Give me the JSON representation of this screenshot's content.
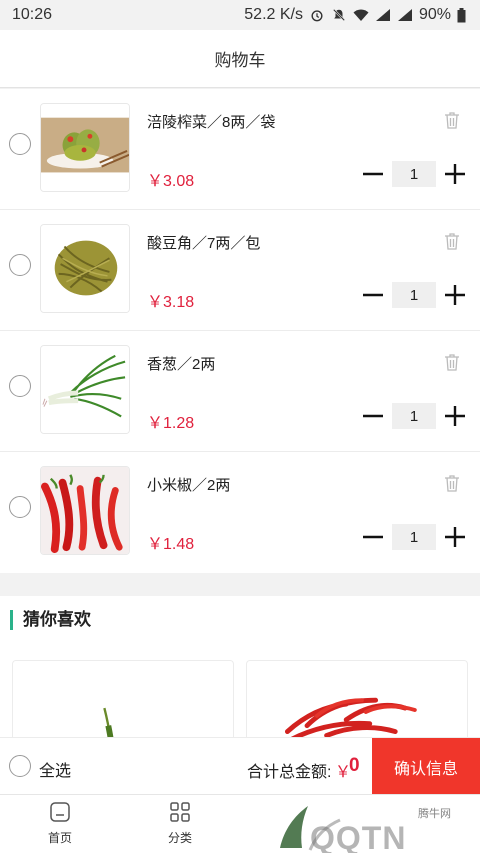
{
  "status_bar": {
    "time": "10:26",
    "speed": "52.2 K/s",
    "battery": "90%"
  },
  "header": {
    "title": "购物车"
  },
  "cart": {
    "items": [
      {
        "name": "涪陵榨菜／8两／袋",
        "price": "￥3.08",
        "qty": "1",
        "image": "pickled-mustard"
      },
      {
        "name": "酸豆角／7两／包",
        "price": "￥3.18",
        "qty": "1",
        "image": "sour-beans"
      },
      {
        "name": "香葱／2两",
        "price": "￥1.28",
        "qty": "1",
        "image": "scallion"
      },
      {
        "name": "小米椒／2两",
        "price": "￥1.48",
        "qty": "1",
        "image": "chili-pepper"
      }
    ]
  },
  "recommend": {
    "title": "猜你喜欢"
  },
  "checkout": {
    "select_all": "全选",
    "total_label": "合计总金额:",
    "currency": "￥",
    "total_value": "0",
    "confirm": "确认信息"
  },
  "tabs": [
    {
      "label": "首页",
      "icon": "home-icon"
    },
    {
      "label": "分类",
      "icon": "grid-icon"
    }
  ],
  "watermark": {
    "brand": "QQTN",
    "site": "腾牛网"
  },
  "colors": {
    "price": "#e0213d",
    "confirm_bg": "#f0362b",
    "accent": "#2ab28a"
  }
}
